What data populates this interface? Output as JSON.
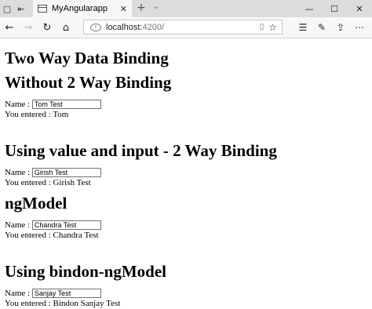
{
  "browser": {
    "tab_title": "MyAngularapp",
    "url_host": "localhost:",
    "url_rest": "4200/"
  },
  "page": {
    "title": "Two Way Data Binding",
    "sections": [
      {
        "heading": "Without 2 Way Binding",
        "label": "Name :",
        "input_value": "Tom Test",
        "output": "You entered : Tom"
      },
      {
        "heading": "Using value and input - 2 Way Binding",
        "label": "Name :",
        "input_value": "Girish Test",
        "output": "You entered : Girish Test"
      },
      {
        "heading": "ngModel",
        "label": "Name :",
        "input_value": "Chandra Test",
        "output": "You entered : Chandra Test"
      },
      {
        "heading": "Using bindon-ngModel",
        "label": "Name :",
        "input_value": "Sanjay Test",
        "output": "You entered : Bindon Sanjay Test"
      }
    ]
  }
}
